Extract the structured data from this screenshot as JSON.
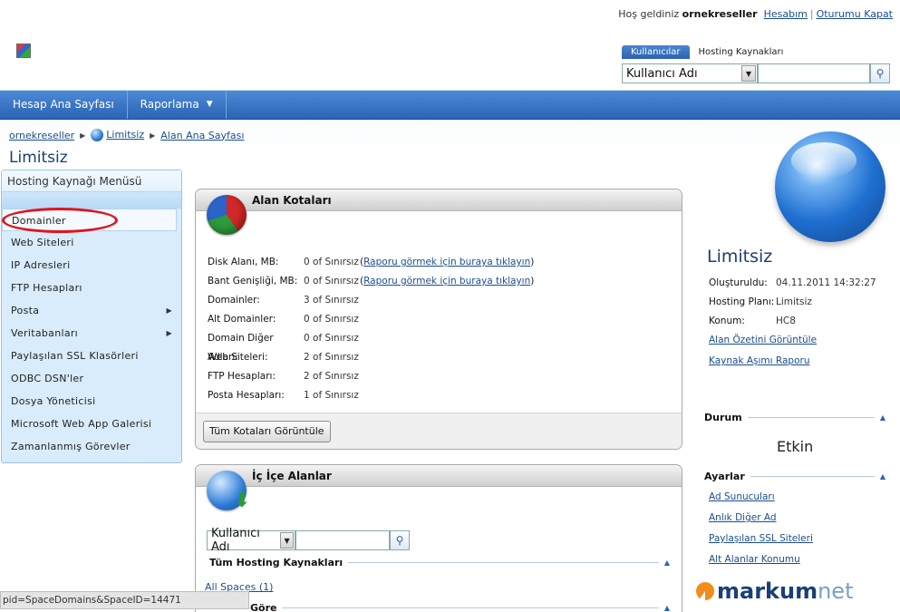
{
  "header": {
    "welcome_prefix": "Hoş geldiniz",
    "username": "ornekreseller",
    "account_link": "Hesabım",
    "logout_link": "Oturumu Kapat"
  },
  "search": {
    "tabs": [
      "Kullanıcılar",
      "Hosting Kaynakları"
    ],
    "selected_field": "Kullanıcı Adı"
  },
  "nav": {
    "items": [
      {
        "label": "Hesap Ana Sayfası"
      },
      {
        "label": "Raporlama"
      }
    ]
  },
  "breadcrumb": {
    "items": [
      "ornekreseller",
      "Limitsiz",
      "Alan Ana Sayfası"
    ]
  },
  "page_title": "Limitsiz",
  "sidebar": {
    "title": "Hosting Kaynağı Menüsü",
    "items": [
      {
        "label": "Domainler"
      },
      {
        "label": "Web Siteleri"
      },
      {
        "label": "IP Adresleri"
      },
      {
        "label": "FTP Hesapları"
      },
      {
        "label": "Posta"
      },
      {
        "label": "Veritabanları"
      },
      {
        "label": "Paylaşılan SSL Klasörleri"
      },
      {
        "label": "ODBC DSN'ler"
      },
      {
        "label": "Dosya Yöneticisi"
      },
      {
        "label": "Microsoft Web App Galerisi"
      },
      {
        "label": "Zamanlanmış Görevler"
      }
    ]
  },
  "quotas": {
    "title": "Alan Kotaları",
    "rows": [
      {
        "label": "Disk Alanı, MB:",
        "value": "0 of Sınırsız",
        "link": "Raporu görmek için buraya tıklayın"
      },
      {
        "label": "Bant Genişliği, MB:",
        "value": "0 of Sınırsız",
        "link": "Raporu görmek için buraya tıklayın"
      },
      {
        "label": "Domainler:",
        "value": "3 of Sınırsız"
      },
      {
        "label": "Alt Domainler:",
        "value": "0 of Sınırsız"
      },
      {
        "label": "Domain Diğer Adları:",
        "value": "0 of Sınırsız"
      },
      {
        "label": "Web Siteleri:",
        "value": "2 of Sınırsız"
      },
      {
        "label": "FTP Hesapları:",
        "value": "2 of Sınırsız"
      },
      {
        "label": "Posta Hesapları:",
        "value": "1 of Sınırsız"
      }
    ],
    "view_all_button": "Tüm Kotaları Görüntüle"
  },
  "nested": {
    "title": "İç İçe Alanlar",
    "search_field": "Kullanıcı Adı",
    "all_spaces_header": "Tüm Hosting Kaynakları",
    "all_spaces_link": "All Spaces (1)",
    "group_header": "Göre"
  },
  "space": {
    "name": "Limitsiz",
    "created_label": "Oluşturuldu:",
    "created_value": "04.11.2011 14:32:27",
    "plan_label": "Hosting Planı:",
    "plan_value": "Limitsiz",
    "location_label": "Konum:",
    "location_value": "HC8",
    "summary_link": "Alan Özetini Görüntüle",
    "overuse_link": "Kaynak Aşımı Raporu"
  },
  "status_section": {
    "title": "Durum",
    "value": "Etkin"
  },
  "settings_section": {
    "title": "Ayarlar",
    "links": [
      "Ad Sunucuları",
      "Anlık Diğer Ad",
      "Paylaşılan SSL Siteleri",
      "Alt Alanlar Konumu"
    ]
  },
  "brand": {
    "part1": "markum",
    "part2": "net"
  },
  "browser_status": "pid=SpaceDomains&SpaceID=14471",
  "colors": {
    "nav": "#2a64b4",
    "accent": "#1a4d8f",
    "highlight": "#e0141e"
  }
}
